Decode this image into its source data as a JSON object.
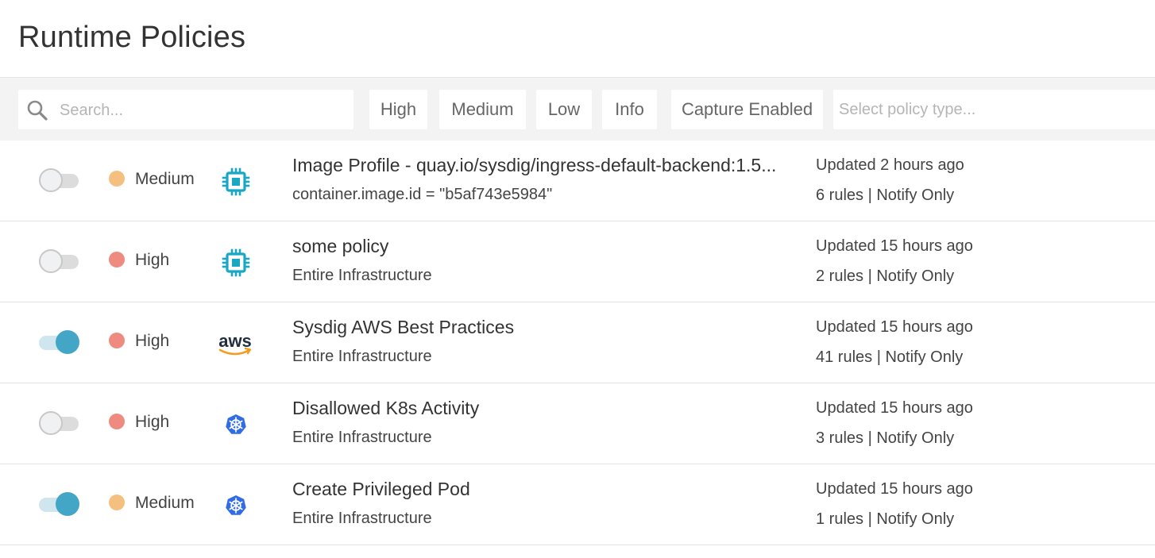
{
  "page": {
    "title": "Runtime Policies"
  },
  "filters": {
    "search_placeholder": "Search...",
    "severity_chips": [
      "High",
      "Medium",
      "Low",
      "Info"
    ],
    "capture_chip": "Capture Enabled",
    "type_placeholder": "Select policy type..."
  },
  "colors": {
    "high": "#ef8a80",
    "medium": "#f5c07f",
    "toggle_on": "#44a6c6",
    "container_icon": "#19a7c4",
    "k8s_icon": "#326ce5",
    "aws_smile": "#f49b21"
  },
  "policies": [
    {
      "enabled": false,
      "severity": "Medium",
      "icon": "container-chip-icon",
      "name": "Image Profile - quay.io/sysdig/ingress-default-backend:1.5...",
      "scope": "container.image.id = \"b5af743e5984\"",
      "updated": "Updated 2 hours ago",
      "rules": "6 rules | Notify Only"
    },
    {
      "enabled": false,
      "severity": "High",
      "icon": "container-chip-icon",
      "name": "some policy",
      "scope": "Entire Infrastructure",
      "updated": "Updated 15 hours ago",
      "rules": "2 rules | Notify Only"
    },
    {
      "enabled": true,
      "severity": "High",
      "icon": "aws-icon",
      "icon_text": "aws",
      "name": "Sysdig AWS Best Practices",
      "scope": "Entire Infrastructure",
      "updated": "Updated 15 hours ago",
      "rules": "41 rules | Notify Only"
    },
    {
      "enabled": false,
      "severity": "High",
      "icon": "kubernetes-icon",
      "name": "Disallowed K8s Activity",
      "scope": "Entire Infrastructure",
      "updated": "Updated 15 hours ago",
      "rules": "3 rules | Notify Only"
    },
    {
      "enabled": true,
      "severity": "Medium",
      "icon": "kubernetes-icon",
      "name": "Create Privileged Pod",
      "scope": "Entire Infrastructure",
      "updated": "Updated 15 hours ago",
      "rules": "1 rules | Notify Only"
    }
  ]
}
